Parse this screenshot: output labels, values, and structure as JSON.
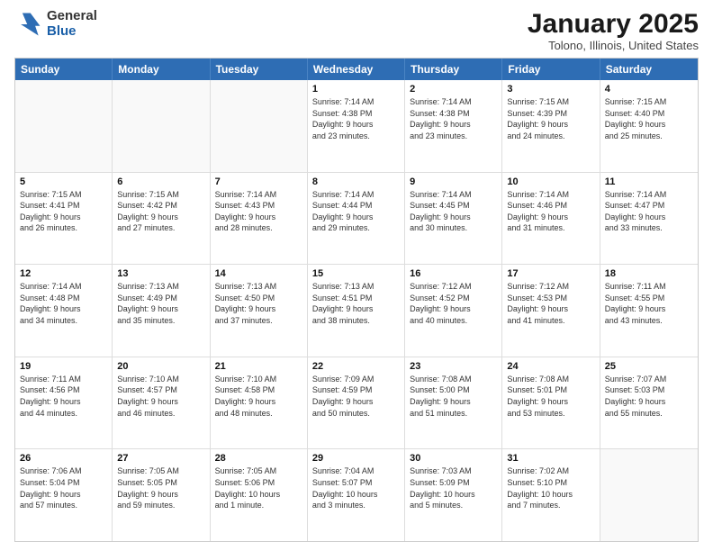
{
  "logo": {
    "general": "General",
    "blue": "Blue"
  },
  "title": "January 2025",
  "location": "Tolono, Illinois, United States",
  "weekdays": [
    "Sunday",
    "Monday",
    "Tuesday",
    "Wednesday",
    "Thursday",
    "Friday",
    "Saturday"
  ],
  "rows": [
    [
      {
        "day": "",
        "info": ""
      },
      {
        "day": "",
        "info": ""
      },
      {
        "day": "",
        "info": ""
      },
      {
        "day": "1",
        "info": "Sunrise: 7:14 AM\nSunset: 4:38 PM\nDaylight: 9 hours\nand 23 minutes."
      },
      {
        "day": "2",
        "info": "Sunrise: 7:14 AM\nSunset: 4:38 PM\nDaylight: 9 hours\nand 23 minutes."
      },
      {
        "day": "3",
        "info": "Sunrise: 7:15 AM\nSunset: 4:39 PM\nDaylight: 9 hours\nand 24 minutes."
      },
      {
        "day": "4",
        "info": "Sunrise: 7:15 AM\nSunset: 4:40 PM\nDaylight: 9 hours\nand 25 minutes."
      }
    ],
    [
      {
        "day": "5",
        "info": "Sunrise: 7:15 AM\nSunset: 4:41 PM\nDaylight: 9 hours\nand 26 minutes."
      },
      {
        "day": "6",
        "info": "Sunrise: 7:15 AM\nSunset: 4:42 PM\nDaylight: 9 hours\nand 27 minutes."
      },
      {
        "day": "7",
        "info": "Sunrise: 7:14 AM\nSunset: 4:43 PM\nDaylight: 9 hours\nand 28 minutes."
      },
      {
        "day": "8",
        "info": "Sunrise: 7:14 AM\nSunset: 4:44 PM\nDaylight: 9 hours\nand 29 minutes."
      },
      {
        "day": "9",
        "info": "Sunrise: 7:14 AM\nSunset: 4:45 PM\nDaylight: 9 hours\nand 30 minutes."
      },
      {
        "day": "10",
        "info": "Sunrise: 7:14 AM\nSunset: 4:46 PM\nDaylight: 9 hours\nand 31 minutes."
      },
      {
        "day": "11",
        "info": "Sunrise: 7:14 AM\nSunset: 4:47 PM\nDaylight: 9 hours\nand 33 minutes."
      }
    ],
    [
      {
        "day": "12",
        "info": "Sunrise: 7:14 AM\nSunset: 4:48 PM\nDaylight: 9 hours\nand 34 minutes."
      },
      {
        "day": "13",
        "info": "Sunrise: 7:13 AM\nSunset: 4:49 PM\nDaylight: 9 hours\nand 35 minutes."
      },
      {
        "day": "14",
        "info": "Sunrise: 7:13 AM\nSunset: 4:50 PM\nDaylight: 9 hours\nand 37 minutes."
      },
      {
        "day": "15",
        "info": "Sunrise: 7:13 AM\nSunset: 4:51 PM\nDaylight: 9 hours\nand 38 minutes."
      },
      {
        "day": "16",
        "info": "Sunrise: 7:12 AM\nSunset: 4:52 PM\nDaylight: 9 hours\nand 40 minutes."
      },
      {
        "day": "17",
        "info": "Sunrise: 7:12 AM\nSunset: 4:53 PM\nDaylight: 9 hours\nand 41 minutes."
      },
      {
        "day": "18",
        "info": "Sunrise: 7:11 AM\nSunset: 4:55 PM\nDaylight: 9 hours\nand 43 minutes."
      }
    ],
    [
      {
        "day": "19",
        "info": "Sunrise: 7:11 AM\nSunset: 4:56 PM\nDaylight: 9 hours\nand 44 minutes."
      },
      {
        "day": "20",
        "info": "Sunrise: 7:10 AM\nSunset: 4:57 PM\nDaylight: 9 hours\nand 46 minutes."
      },
      {
        "day": "21",
        "info": "Sunrise: 7:10 AM\nSunset: 4:58 PM\nDaylight: 9 hours\nand 48 minutes."
      },
      {
        "day": "22",
        "info": "Sunrise: 7:09 AM\nSunset: 4:59 PM\nDaylight: 9 hours\nand 50 minutes."
      },
      {
        "day": "23",
        "info": "Sunrise: 7:08 AM\nSunset: 5:00 PM\nDaylight: 9 hours\nand 51 minutes."
      },
      {
        "day": "24",
        "info": "Sunrise: 7:08 AM\nSunset: 5:01 PM\nDaylight: 9 hours\nand 53 minutes."
      },
      {
        "day": "25",
        "info": "Sunrise: 7:07 AM\nSunset: 5:03 PM\nDaylight: 9 hours\nand 55 minutes."
      }
    ],
    [
      {
        "day": "26",
        "info": "Sunrise: 7:06 AM\nSunset: 5:04 PM\nDaylight: 9 hours\nand 57 minutes."
      },
      {
        "day": "27",
        "info": "Sunrise: 7:05 AM\nSunset: 5:05 PM\nDaylight: 9 hours\nand 59 minutes."
      },
      {
        "day": "28",
        "info": "Sunrise: 7:05 AM\nSunset: 5:06 PM\nDaylight: 10 hours\nand 1 minute."
      },
      {
        "day": "29",
        "info": "Sunrise: 7:04 AM\nSunset: 5:07 PM\nDaylight: 10 hours\nand 3 minutes."
      },
      {
        "day": "30",
        "info": "Sunrise: 7:03 AM\nSunset: 5:09 PM\nDaylight: 10 hours\nand 5 minutes."
      },
      {
        "day": "31",
        "info": "Sunrise: 7:02 AM\nSunset: 5:10 PM\nDaylight: 10 hours\nand 7 minutes."
      },
      {
        "day": "",
        "info": ""
      }
    ]
  ]
}
